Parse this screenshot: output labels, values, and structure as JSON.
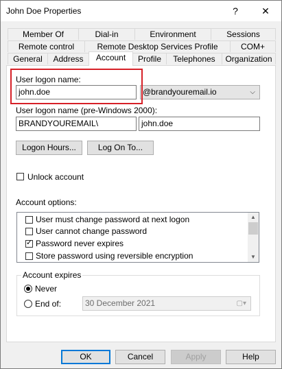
{
  "window": {
    "title": "John Doe Properties",
    "help_label": "?",
    "close_label": "✕"
  },
  "tabs": {
    "row1": [
      "Member Of",
      "Dial-in",
      "Environment",
      "Sessions"
    ],
    "row2": [
      "Remote control",
      "Remote Desktop Services Profile",
      "COM+"
    ],
    "row3": [
      "General",
      "Address",
      "Account",
      "Profile",
      "Telephones",
      "Organization"
    ],
    "active": "Account"
  },
  "account": {
    "upn_label": "User logon name:",
    "upn_value": "john.doe",
    "upn_suffix": "@brandyouremail.io",
    "pre2000_label": "User logon name (pre-Windows 2000):",
    "domain_value": "BRANDYOUREMAIL\\",
    "sam_value": "john.doe",
    "logon_hours_label": "Logon Hours...",
    "logon_to_label": "Log On To...",
    "unlock_label": "Unlock account",
    "options_label": "Account options:",
    "options": [
      {
        "label": "User must change password at next logon",
        "checked": false
      },
      {
        "label": "User cannot change password",
        "checked": false
      },
      {
        "label": "Password never expires",
        "checked": true
      },
      {
        "label": "Store password using reversible encryption",
        "checked": false
      }
    ],
    "expires_group_label": "Account expires",
    "never_label": "Never",
    "end_of_label": "End of:",
    "end_date": "30 December 2021"
  },
  "buttons": {
    "ok": "OK",
    "cancel": "Cancel",
    "apply": "Apply",
    "help": "Help"
  },
  "colors": {
    "highlight": "#d62027",
    "focus": "#0078d7"
  }
}
